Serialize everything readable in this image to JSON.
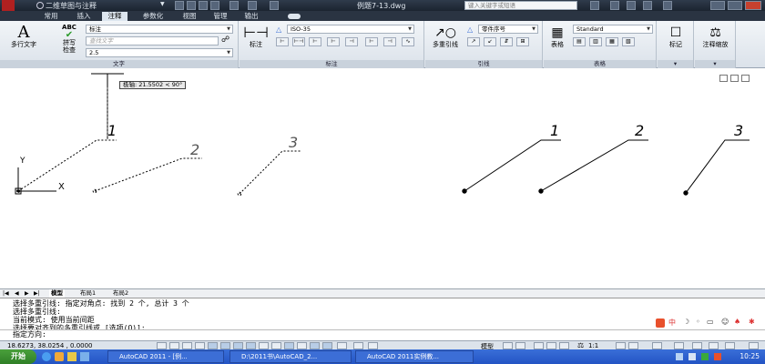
{
  "titlebar": {
    "workspace": "二维草图与注释",
    "filename": "例题7-13.dwg",
    "search_placeholder": "键入关键字或短语"
  },
  "ribbon_tabs": [
    "常用",
    "插入",
    "注释",
    "参数化",
    "视图",
    "管理",
    "输出"
  ],
  "active_tab": "注释",
  "text_panel": {
    "mtext_label": "多行文字",
    "spell_label_1": "拼写",
    "spell_label_2": "检查",
    "abc": "ABC",
    "style_value": "标注",
    "find_placeholder": "查找文字",
    "height_value": "2.5",
    "panel_label": "文字"
  },
  "dim_panel": {
    "dim_label": "标注",
    "style_value": "ISO-35",
    "panel_label": "标注"
  },
  "leader_panel": {
    "mleader_label": "多重引线",
    "style_value": "零件序号",
    "panel_label": "引线"
  },
  "table_panel": {
    "table_label": "表格",
    "style_value": "Standard",
    "panel_label": "表格"
  },
  "markup_panel": {
    "label": "标记"
  },
  "scale_panel": {
    "label": "注释缩放"
  },
  "canvas": {
    "tooltip": "极轴: 21.5502 < 90°",
    "ucs_y": "Y",
    "ucs_x": "X",
    "dashed_balloons": [
      "1",
      "2",
      "3"
    ],
    "solid_balloons": [
      "1",
      "2",
      "3"
    ]
  },
  "layout_tabs": [
    "模型",
    "布局1",
    "布局2"
  ],
  "command": {
    "lines": [
      "选择多重引线: 指定对角点: 找到 2 个, 总计 3 个",
      "选择多重引线:",
      "当前模式: 使用当前间距",
      "选择要对齐到的多重引线或 [选项(O)]:"
    ],
    "prompt": "指定方向:"
  },
  "status": {
    "coords": "18.6273, 38.0254 , 0.0000",
    "model_label": "模型",
    "anno_scale": "1:1"
  },
  "taskbar": {
    "start": "开始",
    "tasks": [
      "AutoCAD 2011 - [例...",
      "D:\\2011书\\AutoCAD_2...",
      "AutoCAD 2011实例教..."
    ],
    "clock": "10:25"
  },
  "ime": {
    "lang": "中"
  },
  "colors": {
    "ribbon_bg": "#dbe2ea",
    "titlebar": "#1b2430",
    "taskbar": "#2354c4",
    "start": "#2f7f26"
  }
}
